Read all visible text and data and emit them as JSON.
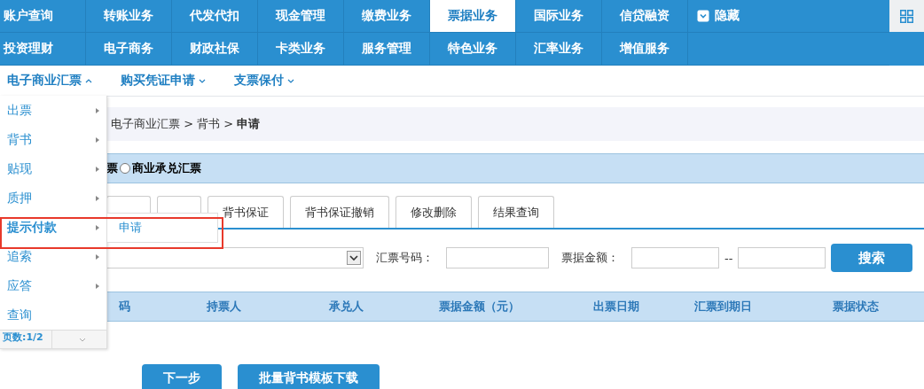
{
  "top_nav": [
    {
      "label": "账户查询",
      "selected": false
    },
    {
      "label": "转账业务",
      "selected": false
    },
    {
      "label": "代发代扣",
      "selected": false
    },
    {
      "label": "现金管理",
      "selected": false
    },
    {
      "label": "缴费业务",
      "selected": false
    },
    {
      "label": "票据业务",
      "selected": true
    },
    {
      "label": "国际业务",
      "selected": false
    },
    {
      "label": "信贷融资",
      "selected": false
    }
  ],
  "top_nav_row2": [
    {
      "label": "投资理财",
      "selected": false
    },
    {
      "label": "电子商务",
      "selected": false
    },
    {
      "label": "财政社保",
      "selected": false
    },
    {
      "label": "卡类业务",
      "selected": false
    },
    {
      "label": "服务管理",
      "selected": false
    },
    {
      "label": "特色业务",
      "selected": false
    },
    {
      "label": "汇率业务",
      "selected": false
    },
    {
      "label": "增值服务",
      "selected": false
    }
  ],
  "hide_toggle": "隐藏",
  "sub_nav": [
    {
      "label": "电子商业汇票",
      "expanded": true
    },
    {
      "label": "购买凭证申请",
      "expanded": false
    },
    {
      "label": "支票保付",
      "expanded": false
    }
  ],
  "menu": {
    "items": [
      {
        "label": "出票",
        "selected": false
      },
      {
        "label": "背书",
        "selected": false
      },
      {
        "label": "贴现",
        "selected": false
      },
      {
        "label": "质押",
        "selected": false
      },
      {
        "label": "提示付款",
        "selected": true
      },
      {
        "label": "追索",
        "selected": false
      },
      {
        "label": "应答",
        "selected": false
      }
    ],
    "last_item": "查询",
    "pager": "页数:1/2",
    "submenu": [
      "申请"
    ]
  },
  "breadcrumb": "电子商业汇票 > 背书 > **申请**",
  "bill_type": {
    "cut_label": "票",
    "options": [
      {
        "label": "商业承兑汇票",
        "selected": false
      }
    ]
  },
  "tabs": [
    {
      "label": "背书保证",
      "selected": false
    },
    {
      "label": "背书保证撤销",
      "selected": false
    },
    {
      "label": "修改删除",
      "selected": false
    },
    {
      "label": "结果查询",
      "selected": false
    }
  ],
  "filters": {
    "bill_no_label": "汇票号码：",
    "amount_label": "票据金额：",
    "range_sep": "--",
    "search_button": "搜索"
  },
  "table": {
    "columns": [
      "码",
      "持票人",
      "承兑人",
      "票据金额（元）",
      "出票日期",
      "汇票到期日",
      "票据状态"
    ]
  },
  "buttons": [
    "下一步",
    "批量背书模板下载"
  ]
}
